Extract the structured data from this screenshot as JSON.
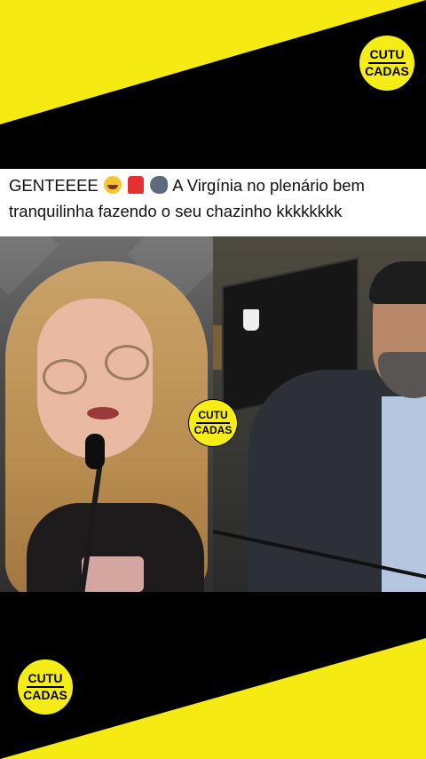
{
  "brand": {
    "line1": "CUTU",
    "line2": "CADAS"
  },
  "caption": {
    "prefix": "GENTEEEE",
    "emojis": [
      "rolling-laughing-emoji",
      "siren-emoji",
      "speaking-head-emoji"
    ],
    "text": "A Virgínia no plenário bem tranquilinha fazendo o seu chazinho kkkkkkkk"
  },
  "colors": {
    "accent_yellow": "#f5ea12",
    "background": "#000000",
    "caption_bg": "#ffffff"
  }
}
